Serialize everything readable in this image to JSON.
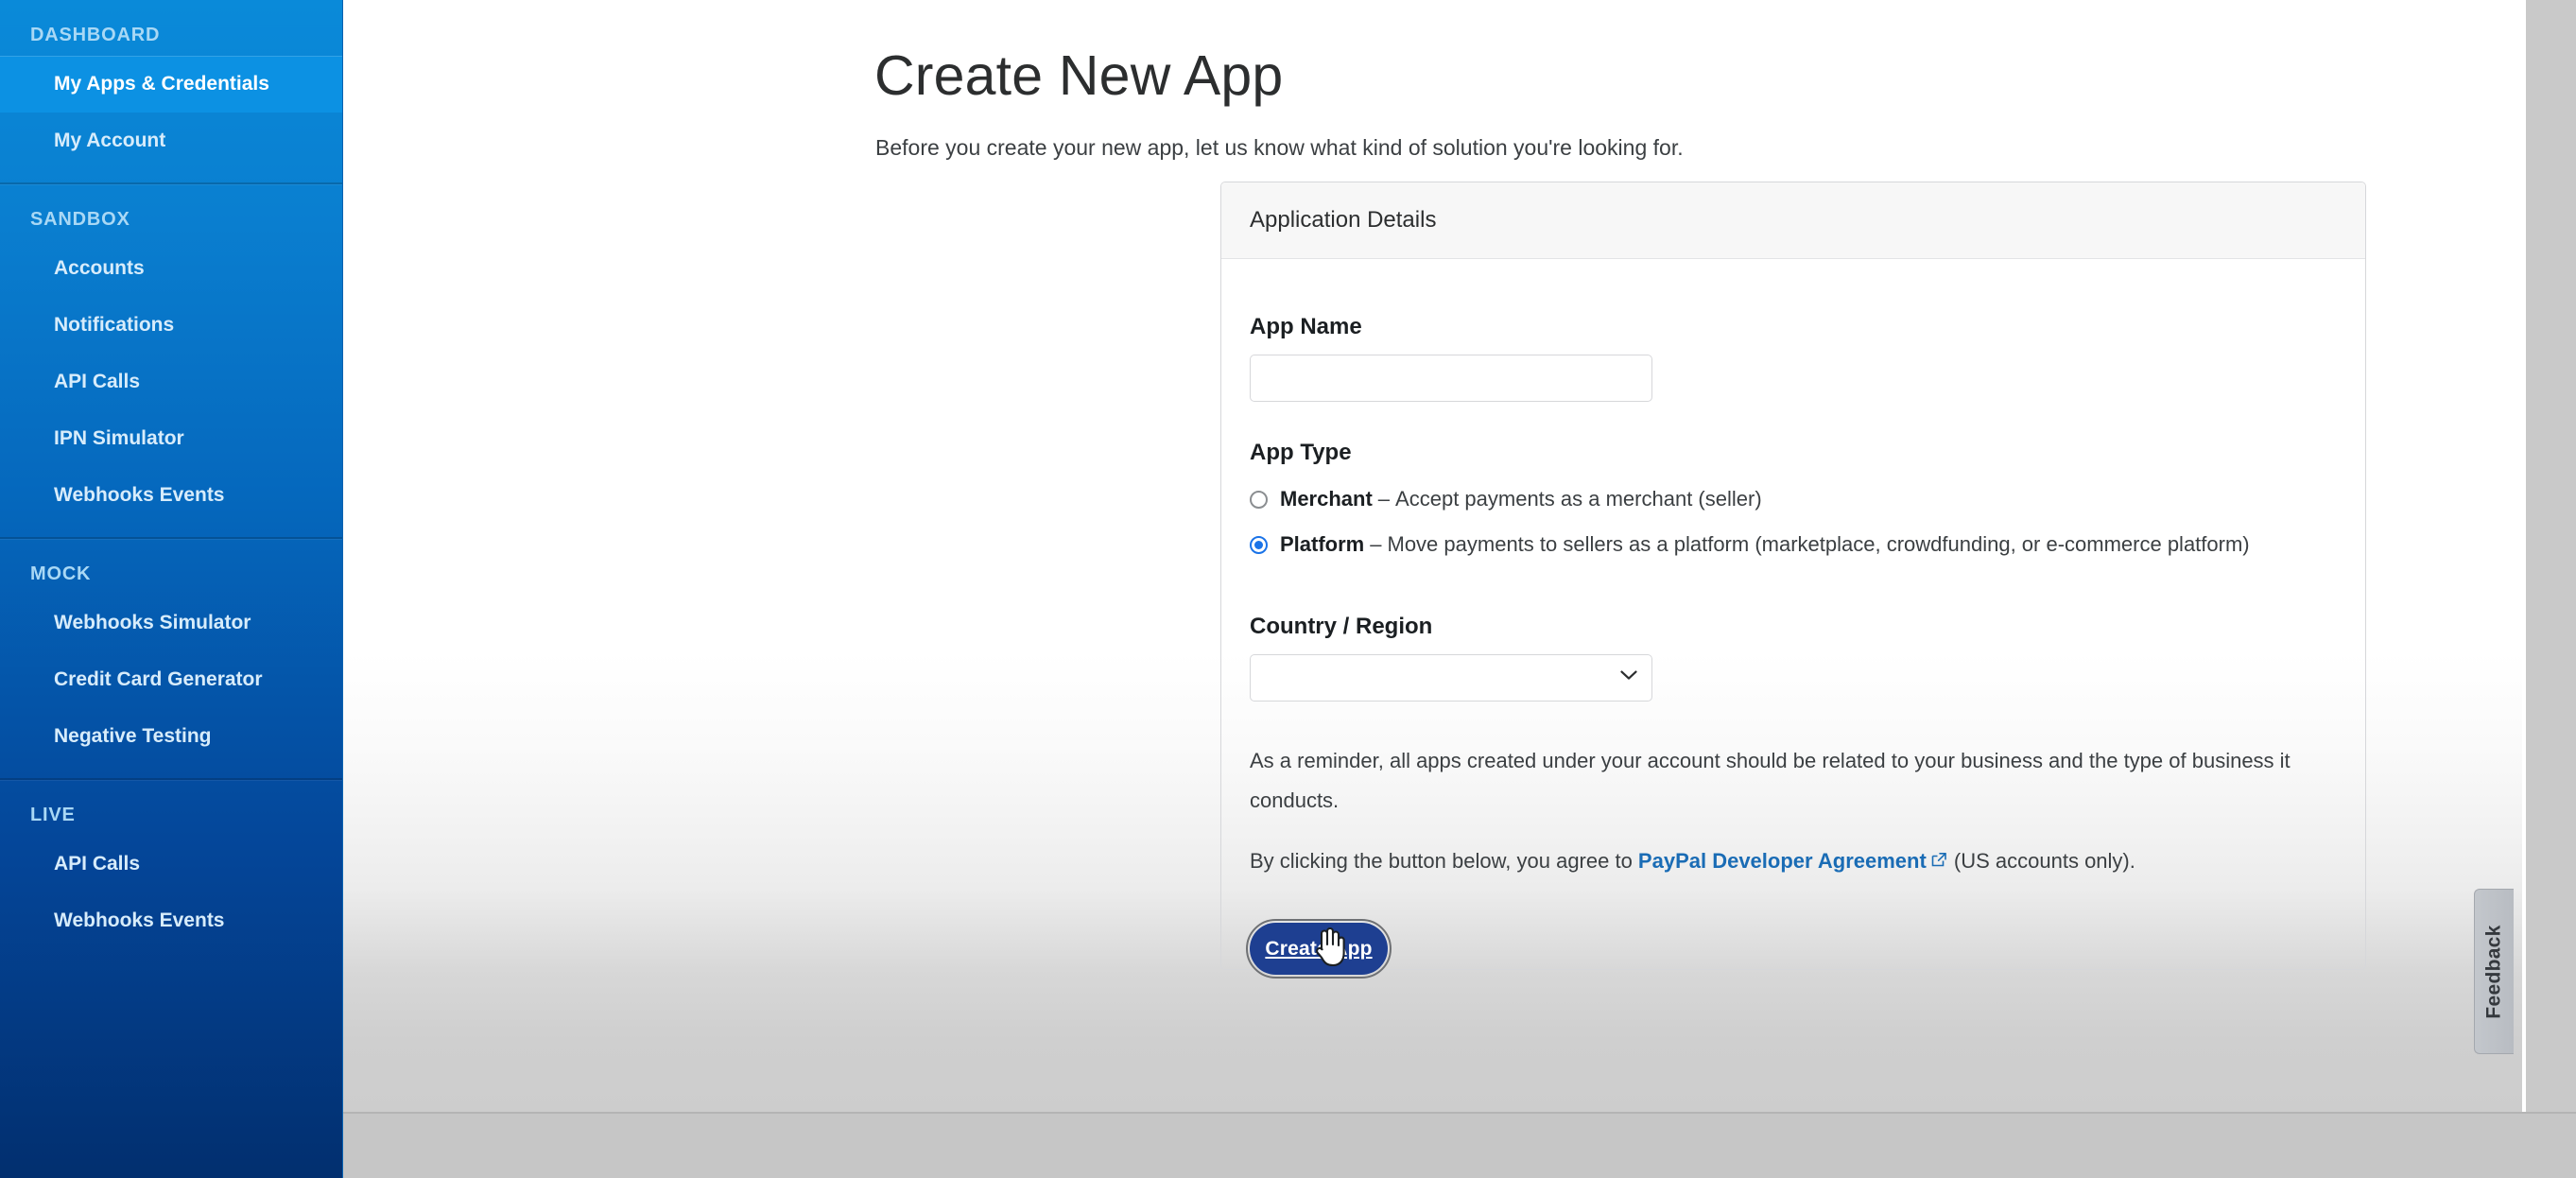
{
  "sidebar": {
    "sections": [
      {
        "header": "DASHBOARD",
        "items": [
          {
            "label": "My Apps & Credentials",
            "active": true
          },
          {
            "label": "My Account",
            "active": false
          }
        ]
      },
      {
        "header": "SANDBOX",
        "items": [
          {
            "label": "Accounts",
            "active": false
          },
          {
            "label": "Notifications",
            "active": false
          },
          {
            "label": "API Calls",
            "active": false
          },
          {
            "label": "IPN Simulator",
            "active": false
          },
          {
            "label": "Webhooks Events",
            "active": false
          }
        ]
      },
      {
        "header": "MOCK",
        "items": [
          {
            "label": "Webhooks Simulator",
            "active": false
          },
          {
            "label": "Credit Card Generator",
            "active": false
          },
          {
            "label": "Negative Testing",
            "active": false
          }
        ]
      },
      {
        "header": "LIVE",
        "items": [
          {
            "label": "API Calls",
            "active": false
          },
          {
            "label": "Webhooks Events",
            "active": false
          }
        ]
      }
    ]
  },
  "main": {
    "title": "Create New App",
    "subtitle": "Before you create your new app, let us know what kind of solution you're looking for.",
    "card": {
      "header_title": "Application Details",
      "app_name": {
        "label": "App Name",
        "value": "",
        "placeholder": ""
      },
      "app_type": {
        "label": "App Type",
        "options": [
          {
            "name": "Merchant",
            "dash": "–",
            "description": "Accept payments as a merchant (seller)",
            "selected": false
          },
          {
            "name": "Platform",
            "dash": "–",
            "description": "Move payments to sellers as a platform (marketplace, crowdfunding, or e-commerce platform)",
            "selected": true
          }
        ]
      },
      "country": {
        "label": "Country / Region",
        "selected_value": "",
        "options": [
          ""
        ]
      },
      "reminder_text": "As a reminder, all apps created under your account should be related to your business and the type of business it conducts.",
      "agreement_prefix": "By clicking the button below, you agree to ",
      "agreement_link": "PayPal Developer Agreement",
      "agreement_suffix": " (US accounts only).",
      "submit_label": "Create App"
    }
  },
  "feedback": {
    "label": "Feedback"
  },
  "colors": {
    "sidebar_top": "#0a8ad9",
    "sidebar_bottom": "#022f6f",
    "sidebar_active": "#0c91e3",
    "radio_selected": "#1a73e8",
    "link": "#1a6cb5",
    "button_bg": "#1e3f91"
  }
}
